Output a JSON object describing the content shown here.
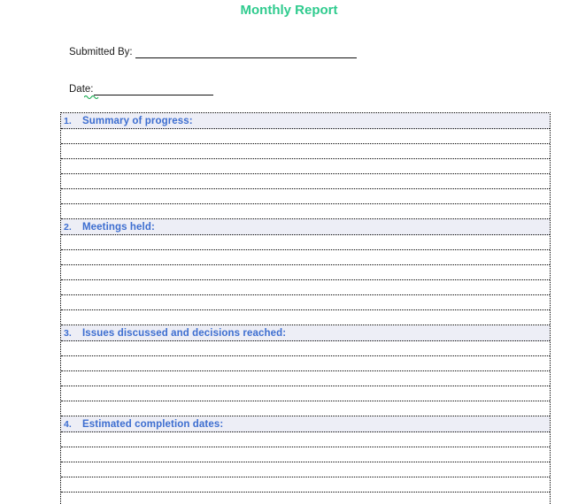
{
  "title": "Monthly Report",
  "colors": {
    "title_green": "#2fcb8e",
    "heading_blue": "#3d6ed0",
    "header_row_bg": "#edeef6",
    "table_border": "#000000",
    "spellcheck_squiggle": "#00a33e"
  },
  "fields": {
    "submitted_by": {
      "label": "Submitted By:",
      "value": ""
    },
    "date": {
      "label": "Date:",
      "value": ""
    }
  },
  "sections": [
    {
      "number": "1.",
      "heading": "Summary of progress:",
      "blank_rows": 6
    },
    {
      "number": "2.",
      "heading": "Meetings held:",
      "blank_rows": 6
    },
    {
      "number": "3.",
      "heading": "Issues discussed and decisions reached:",
      "blank_rows": 5
    },
    {
      "number": "4.",
      "heading": "Estimated completion dates:",
      "blank_rows": 5
    }
  ]
}
